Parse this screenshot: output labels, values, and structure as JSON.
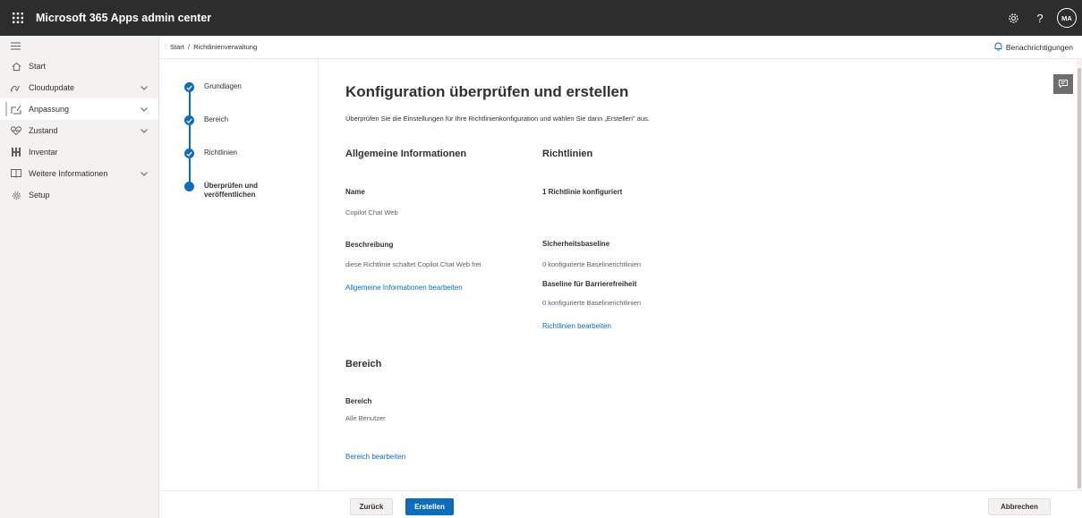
{
  "app": {
    "title": "Microsoft 365 Apps admin center",
    "avatar_initials": "MA"
  },
  "topbar": {
    "icons": [
      "waffle-icon",
      "gear-icon",
      "help-icon"
    ],
    "help_glyph": "?"
  },
  "nav": {
    "items": [
      {
        "label": "Start",
        "icon": "home-icon",
        "has_chevron": false
      },
      {
        "label": "Cloudupdate",
        "icon": "cloud-update-icon",
        "has_chevron": true
      },
      {
        "label": "Anpassung",
        "icon": "customize-icon",
        "has_chevron": true,
        "selected": true
      },
      {
        "label": "Zustand",
        "icon": "heart-icon",
        "has_chevron": true
      },
      {
        "label": "Inventar",
        "icon": "inventory-icon",
        "has_chevron": false
      },
      {
        "label": "Weitere Informationen",
        "icon": "book-icon",
        "has_chevron": true
      },
      {
        "label": "Setup",
        "icon": "setup-gear-icon",
        "has_chevron": false
      }
    ]
  },
  "breadcrumb": {
    "text": "Start  /  Richtlinienverwaltung"
  },
  "notifications": {
    "label": "Benachrichtigungen"
  },
  "stepper": {
    "steps": [
      {
        "label": "Grundlagen",
        "status": "complete"
      },
      {
        "label": "Bereich",
        "status": "complete"
      },
      {
        "label": "Richtlinien",
        "status": "complete"
      },
      {
        "label": "Überprüfen und veröffentlichen",
        "status": "current"
      }
    ]
  },
  "main": {
    "title": "Konfiguration überprüfen und erstellen",
    "intro": "Überprüfen Sie die Einstellungen für Ihre Richtlinienkonfiguration und wählen Sie dann „Erstellen\" aus.",
    "general": {
      "heading": "Allgemeine Informationen",
      "name_label": "Name",
      "name_value": "Copilot Chat Web",
      "desc_label": "Beschreibung",
      "desc_value": "diese Richtlinie schaltet Copilot Chat Web frei",
      "edit_link": "Allgemeine Informationen bearbeiten"
    },
    "policies": {
      "heading": "Richtlinien",
      "configured": "1 Richtlinie konfiguriert",
      "security_label": "Sicherheitsbaseline",
      "security_value": "0 konfigurierte Baselinerichtlinien",
      "access_label": "Baseline für Barrierefreiheit",
      "access_value": "0 konfigurierte Baselinerichtlinien",
      "edit_link": "Richtlinien bearbeiten"
    },
    "scope": {
      "heading": "Bereich",
      "label": "Bereich",
      "value": "Alle Benutzer",
      "edit_link": "Bereich bearbeiten"
    }
  },
  "footer": {
    "back": "Zurück",
    "create": "Erstellen",
    "cancel": "Abbrechen"
  },
  "colors": {
    "topbar": "#2d2d2d",
    "accent": "#0f6cbd",
    "nav_bg": "#f3f2f1"
  }
}
